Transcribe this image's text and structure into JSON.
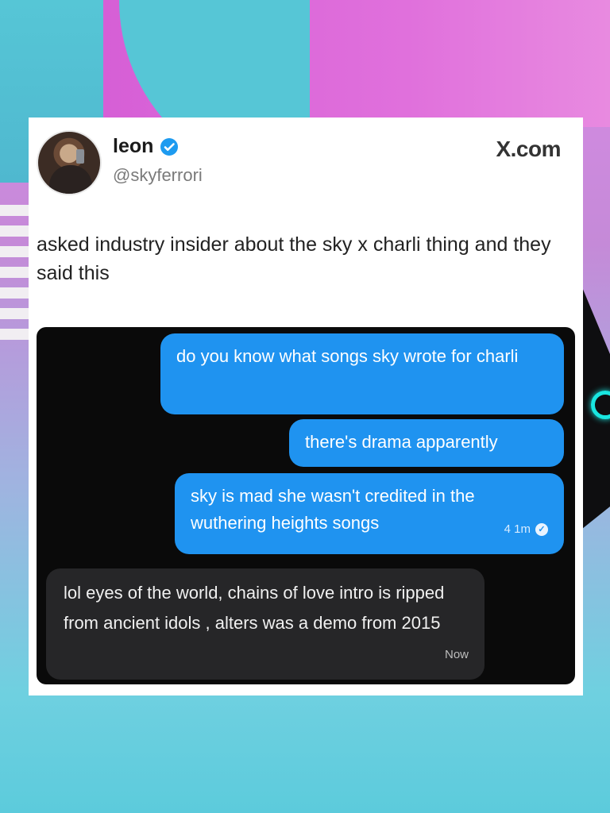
{
  "post": {
    "display_name": "leon",
    "handle": "@skyferrori",
    "source": "X.com",
    "text": "asked industry insider about the sky x charli thing and they said this"
  },
  "chat": {
    "outgoing": [
      {
        "text": "do you know what songs sky wrote for charli"
      },
      {
        "text": "there's drama apparently"
      },
      {
        "text": "sky is mad she wasn't credited in the wuthering heights songs",
        "time": "4 1m"
      }
    ],
    "incoming": {
      "text": "lol eyes of the world, chains of love intro is ripped from ancient idols , alters was a demo from 2015",
      "time": "Now"
    }
  },
  "colors": {
    "outgoing_bubble": "#1f93f0",
    "incoming_bubble": "#262628",
    "chat_background": "#0a0a0a",
    "verified_badge": "#1d9bf0"
  },
  "icons": {
    "verified": "verified-badge-icon",
    "read_receipt": "read-check-icon"
  }
}
